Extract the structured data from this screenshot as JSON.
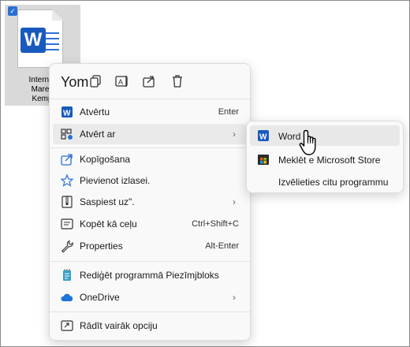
{
  "file": {
    "name_lines": [
      "Internets",
      "Mareks",
      "Kemps"
    ],
    "icon": "word-document-icon",
    "badge": "W"
  },
  "context_menu": {
    "toolbar": {
      "leading_text": "Yom",
      "icons": [
        "copy-icon",
        "rename-icon",
        "share-icon",
        "delete-icon"
      ]
    },
    "items": [
      {
        "label": "Atvērtu",
        "shortcut": "Enter",
        "icon": "word-icon"
      },
      {
        "label": "Atvērt ar",
        "icon": "open-with-icon",
        "submenu": true
      },
      {
        "label": "Kopīgošana",
        "icon": "share-icon"
      },
      {
        "label": "Pievienot izlasei.",
        "icon": "star-icon"
      },
      {
        "label": "Saspiest uz\".",
        "icon": "zip-icon",
        "submenu": true
      },
      {
        "label": "Kopēt kā ceļu",
        "shortcut": "Ctrl+Shift+C",
        "icon": "path-icon"
      },
      {
        "label": "Properties",
        "shortcut": "Alt-Enter",
        "icon": "wrench-icon"
      },
      {
        "label": "Rediģēt programmā Piezīmjbloks",
        "icon": "notepad-icon"
      },
      {
        "label": "OneDrive",
        "icon": "cloud-icon",
        "submenu": true
      },
      {
        "label": "Rādīt vairāk opciju",
        "icon": "more-options-icon"
      }
    ]
  },
  "submenu": {
    "items": [
      {
        "label": "Word",
        "icon": "word-icon"
      },
      {
        "label": "Meklēt e Microsoft Store",
        "icon": "store-icon"
      },
      {
        "label": "Izvēlieties citu programmu"
      }
    ]
  },
  "colors": {
    "word_blue": "#185abd",
    "accent": "#2b6fd3"
  }
}
